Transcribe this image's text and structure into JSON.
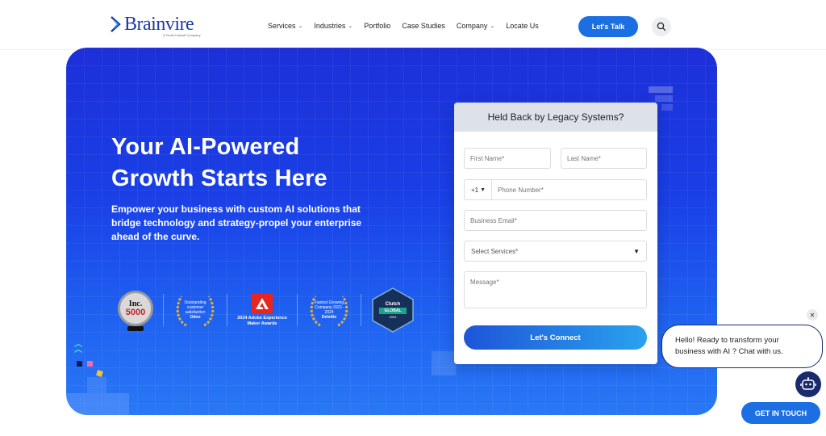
{
  "header": {
    "logo_text": "Brainvire",
    "logo_tagline": "A Tech9 Infosoft Company",
    "nav": [
      {
        "label": "Services",
        "dropdown": true
      },
      {
        "label": "Industries",
        "dropdown": true
      },
      {
        "label": "Portfolio",
        "dropdown": false
      },
      {
        "label": "Case Studies",
        "dropdown": false
      },
      {
        "label": "Company",
        "dropdown": true
      },
      {
        "label": "Locate Us",
        "dropdown": false
      }
    ],
    "cta_label": "Let's Talk",
    "search_icon": "search-icon"
  },
  "hero": {
    "title_line1": "Your AI-Powered",
    "title_line2": "Growth Starts Here",
    "subtitle": "Empower your business with custom AI solutions that bridge technology and strategy-propel your enterprise ahead of the curve.",
    "awards": {
      "inc_line1": "Inc.",
      "inc_line2": "5000",
      "odoo_text": "Outstanding customer satisfaction",
      "odoo_brand": "Odoo",
      "adobe_text": "2024 Adobe Experience Maker Awards",
      "deloitte_text": "Fastest Growing Company 2021-2024",
      "deloitte_brand": "Deloitte",
      "clutch_brand": "Clutch",
      "clutch_badge": "GLOBAL",
      "clutch_year": "2024"
    }
  },
  "form": {
    "heading": "Held Back by Legacy Systems?",
    "first_name_placeholder": "First Name*",
    "last_name_placeholder": "Last Name*",
    "phone_code": "+1",
    "phone_placeholder": "Phone Number*",
    "email_placeholder": "Business Email*",
    "services_placeholder": "Select Services*",
    "message_placeholder": "Message*",
    "submit_label": "Let's Connect"
  },
  "chat": {
    "close_glyph": "✕",
    "message": "Hello! Ready to transform your business with AI ? Chat with us.",
    "bot_icon": "robot-icon",
    "cta_label": "GET IN TOUCH"
  },
  "colors": {
    "brand_blue": "#1c6fe3",
    "hero_top": "#1d2fd8",
    "hero_bottom": "#2a78f5",
    "chat_border": "#1a2a6c"
  }
}
